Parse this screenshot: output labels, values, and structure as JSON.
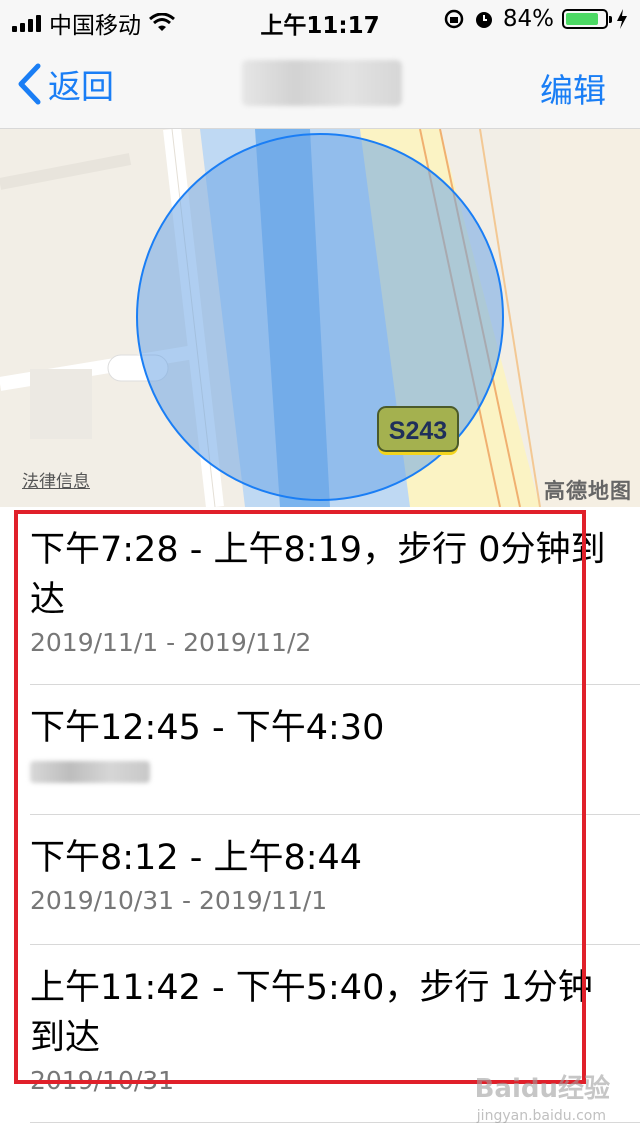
{
  "status_bar": {
    "carrier": "中国移动",
    "time": "上午11:17",
    "battery_percent": "84%",
    "battery_level": 0.84
  },
  "nav": {
    "back_label": "返回",
    "edit_label": "编辑"
  },
  "map": {
    "road_label": "S243",
    "legal_label": "法律信息",
    "provider_label": "高德地图"
  },
  "visits": [
    {
      "title": "下午7:28 - 上午8:19，步行 0分钟到达",
      "subtitle": "2019/11/1 - 2019/11/2"
    },
    {
      "title": "下午12:45 - 下午4:30",
      "subtitle": ""
    },
    {
      "title": "下午8:12 - 上午8:44",
      "subtitle": "2019/10/31 - 2019/11/1"
    },
    {
      "title": "上午11:42 - 下午5:40，步行 1分钟到达",
      "subtitle": "2019/10/31"
    }
  ],
  "watermark": {
    "text": "Baidu经验",
    "url": "jingyan.baidu.com"
  },
  "colors": {
    "accent": "#1a7ef5",
    "highlight_border": "#e0202a",
    "battery": "#4cd964",
    "map_circle": "#7fb0e8"
  }
}
